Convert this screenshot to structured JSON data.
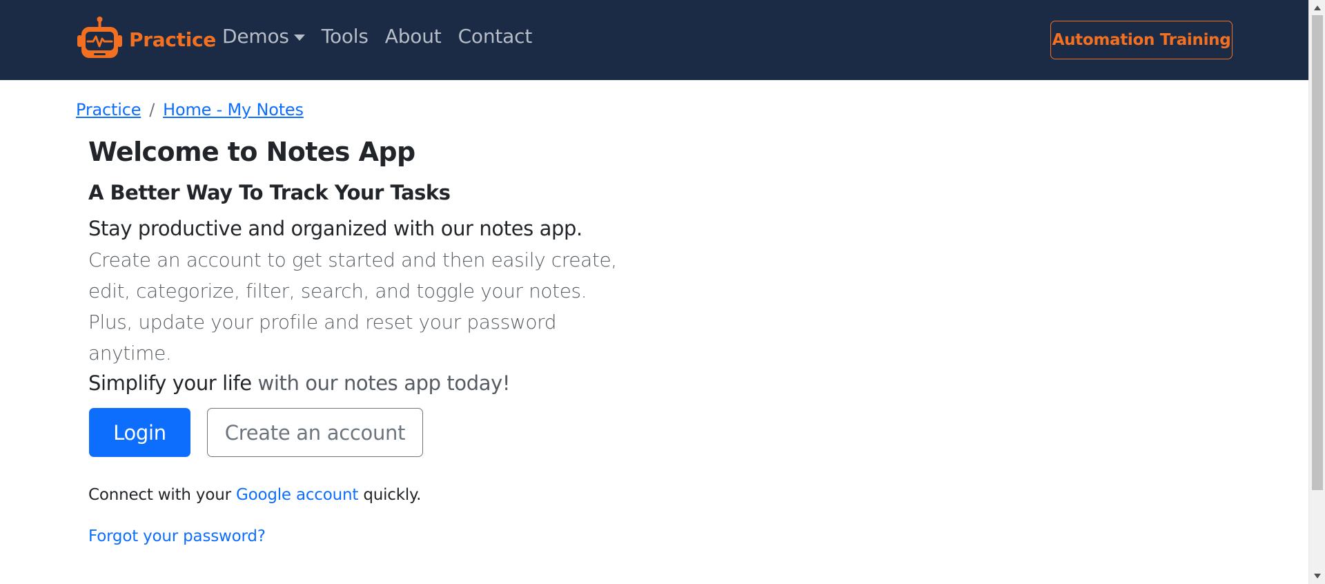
{
  "navbar": {
    "brand_label": "Practice",
    "items": [
      {
        "label": "Demos",
        "has_dropdown": true
      },
      {
        "label": "Tools"
      },
      {
        "label": "About"
      },
      {
        "label": "Contact"
      }
    ],
    "cta_label": "Automation Training",
    "logo_icon": "robot-icon",
    "background_color": "#1b2b45",
    "accent_color": "#f37021"
  },
  "breadcrumb": {
    "items": [
      "Practice",
      "Home - My Notes"
    ],
    "separator": "/"
  },
  "main": {
    "title": "Welcome to Notes App",
    "subtitle": "A Better Way To Track Your Tasks",
    "lead": "Stay productive and organized with our notes app.",
    "description": "Create an account to get started and then easily create, edit, categorize, filter, search, and toggle your notes. Plus, update your profile and reset your password anytime.",
    "simplify_strong": "Simplify your life",
    "simplify_rest": " with our notes app today!",
    "login_label": "Login",
    "create_account_label": "Create an account",
    "connect_prefix": "Connect with your ",
    "google_link": "Google account",
    "connect_suffix": " quickly.",
    "forgot_password": "Forgot your password?",
    "primary_color": "#0d6efd"
  }
}
